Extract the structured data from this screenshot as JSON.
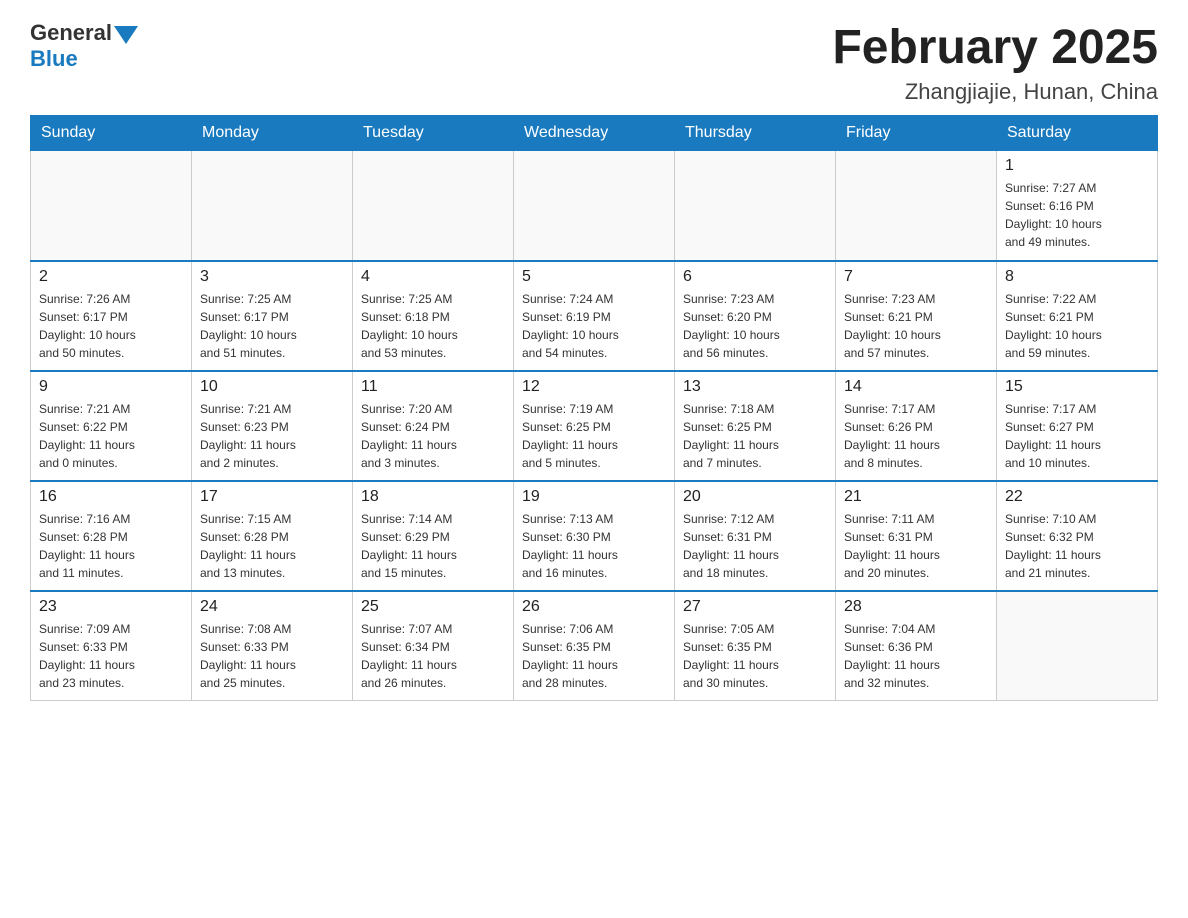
{
  "header": {
    "logo_general": "General",
    "logo_blue": "Blue",
    "title": "February 2025",
    "subtitle": "Zhangjiajie, Hunan, China"
  },
  "days_of_week": [
    "Sunday",
    "Monday",
    "Tuesday",
    "Wednesday",
    "Thursday",
    "Friday",
    "Saturday"
  ],
  "weeks": [
    [
      {
        "day": "",
        "info": ""
      },
      {
        "day": "",
        "info": ""
      },
      {
        "day": "",
        "info": ""
      },
      {
        "day": "",
        "info": ""
      },
      {
        "day": "",
        "info": ""
      },
      {
        "day": "",
        "info": ""
      },
      {
        "day": "1",
        "info": "Sunrise: 7:27 AM\nSunset: 6:16 PM\nDaylight: 10 hours\nand 49 minutes."
      }
    ],
    [
      {
        "day": "2",
        "info": "Sunrise: 7:26 AM\nSunset: 6:17 PM\nDaylight: 10 hours\nand 50 minutes."
      },
      {
        "day": "3",
        "info": "Sunrise: 7:25 AM\nSunset: 6:17 PM\nDaylight: 10 hours\nand 51 minutes."
      },
      {
        "day": "4",
        "info": "Sunrise: 7:25 AM\nSunset: 6:18 PM\nDaylight: 10 hours\nand 53 minutes."
      },
      {
        "day": "5",
        "info": "Sunrise: 7:24 AM\nSunset: 6:19 PM\nDaylight: 10 hours\nand 54 minutes."
      },
      {
        "day": "6",
        "info": "Sunrise: 7:23 AM\nSunset: 6:20 PM\nDaylight: 10 hours\nand 56 minutes."
      },
      {
        "day": "7",
        "info": "Sunrise: 7:23 AM\nSunset: 6:21 PM\nDaylight: 10 hours\nand 57 minutes."
      },
      {
        "day": "8",
        "info": "Sunrise: 7:22 AM\nSunset: 6:21 PM\nDaylight: 10 hours\nand 59 minutes."
      }
    ],
    [
      {
        "day": "9",
        "info": "Sunrise: 7:21 AM\nSunset: 6:22 PM\nDaylight: 11 hours\nand 0 minutes."
      },
      {
        "day": "10",
        "info": "Sunrise: 7:21 AM\nSunset: 6:23 PM\nDaylight: 11 hours\nand 2 minutes."
      },
      {
        "day": "11",
        "info": "Sunrise: 7:20 AM\nSunset: 6:24 PM\nDaylight: 11 hours\nand 3 minutes."
      },
      {
        "day": "12",
        "info": "Sunrise: 7:19 AM\nSunset: 6:25 PM\nDaylight: 11 hours\nand 5 minutes."
      },
      {
        "day": "13",
        "info": "Sunrise: 7:18 AM\nSunset: 6:25 PM\nDaylight: 11 hours\nand 7 minutes."
      },
      {
        "day": "14",
        "info": "Sunrise: 7:17 AM\nSunset: 6:26 PM\nDaylight: 11 hours\nand 8 minutes."
      },
      {
        "day": "15",
        "info": "Sunrise: 7:17 AM\nSunset: 6:27 PM\nDaylight: 11 hours\nand 10 minutes."
      }
    ],
    [
      {
        "day": "16",
        "info": "Sunrise: 7:16 AM\nSunset: 6:28 PM\nDaylight: 11 hours\nand 11 minutes."
      },
      {
        "day": "17",
        "info": "Sunrise: 7:15 AM\nSunset: 6:28 PM\nDaylight: 11 hours\nand 13 minutes."
      },
      {
        "day": "18",
        "info": "Sunrise: 7:14 AM\nSunset: 6:29 PM\nDaylight: 11 hours\nand 15 minutes."
      },
      {
        "day": "19",
        "info": "Sunrise: 7:13 AM\nSunset: 6:30 PM\nDaylight: 11 hours\nand 16 minutes."
      },
      {
        "day": "20",
        "info": "Sunrise: 7:12 AM\nSunset: 6:31 PM\nDaylight: 11 hours\nand 18 minutes."
      },
      {
        "day": "21",
        "info": "Sunrise: 7:11 AM\nSunset: 6:31 PM\nDaylight: 11 hours\nand 20 minutes."
      },
      {
        "day": "22",
        "info": "Sunrise: 7:10 AM\nSunset: 6:32 PM\nDaylight: 11 hours\nand 21 minutes."
      }
    ],
    [
      {
        "day": "23",
        "info": "Sunrise: 7:09 AM\nSunset: 6:33 PM\nDaylight: 11 hours\nand 23 minutes."
      },
      {
        "day": "24",
        "info": "Sunrise: 7:08 AM\nSunset: 6:33 PM\nDaylight: 11 hours\nand 25 minutes."
      },
      {
        "day": "25",
        "info": "Sunrise: 7:07 AM\nSunset: 6:34 PM\nDaylight: 11 hours\nand 26 minutes."
      },
      {
        "day": "26",
        "info": "Sunrise: 7:06 AM\nSunset: 6:35 PM\nDaylight: 11 hours\nand 28 minutes."
      },
      {
        "day": "27",
        "info": "Sunrise: 7:05 AM\nSunset: 6:35 PM\nDaylight: 11 hours\nand 30 minutes."
      },
      {
        "day": "28",
        "info": "Sunrise: 7:04 AM\nSunset: 6:36 PM\nDaylight: 11 hours\nand 32 minutes."
      },
      {
        "day": "",
        "info": ""
      }
    ]
  ]
}
